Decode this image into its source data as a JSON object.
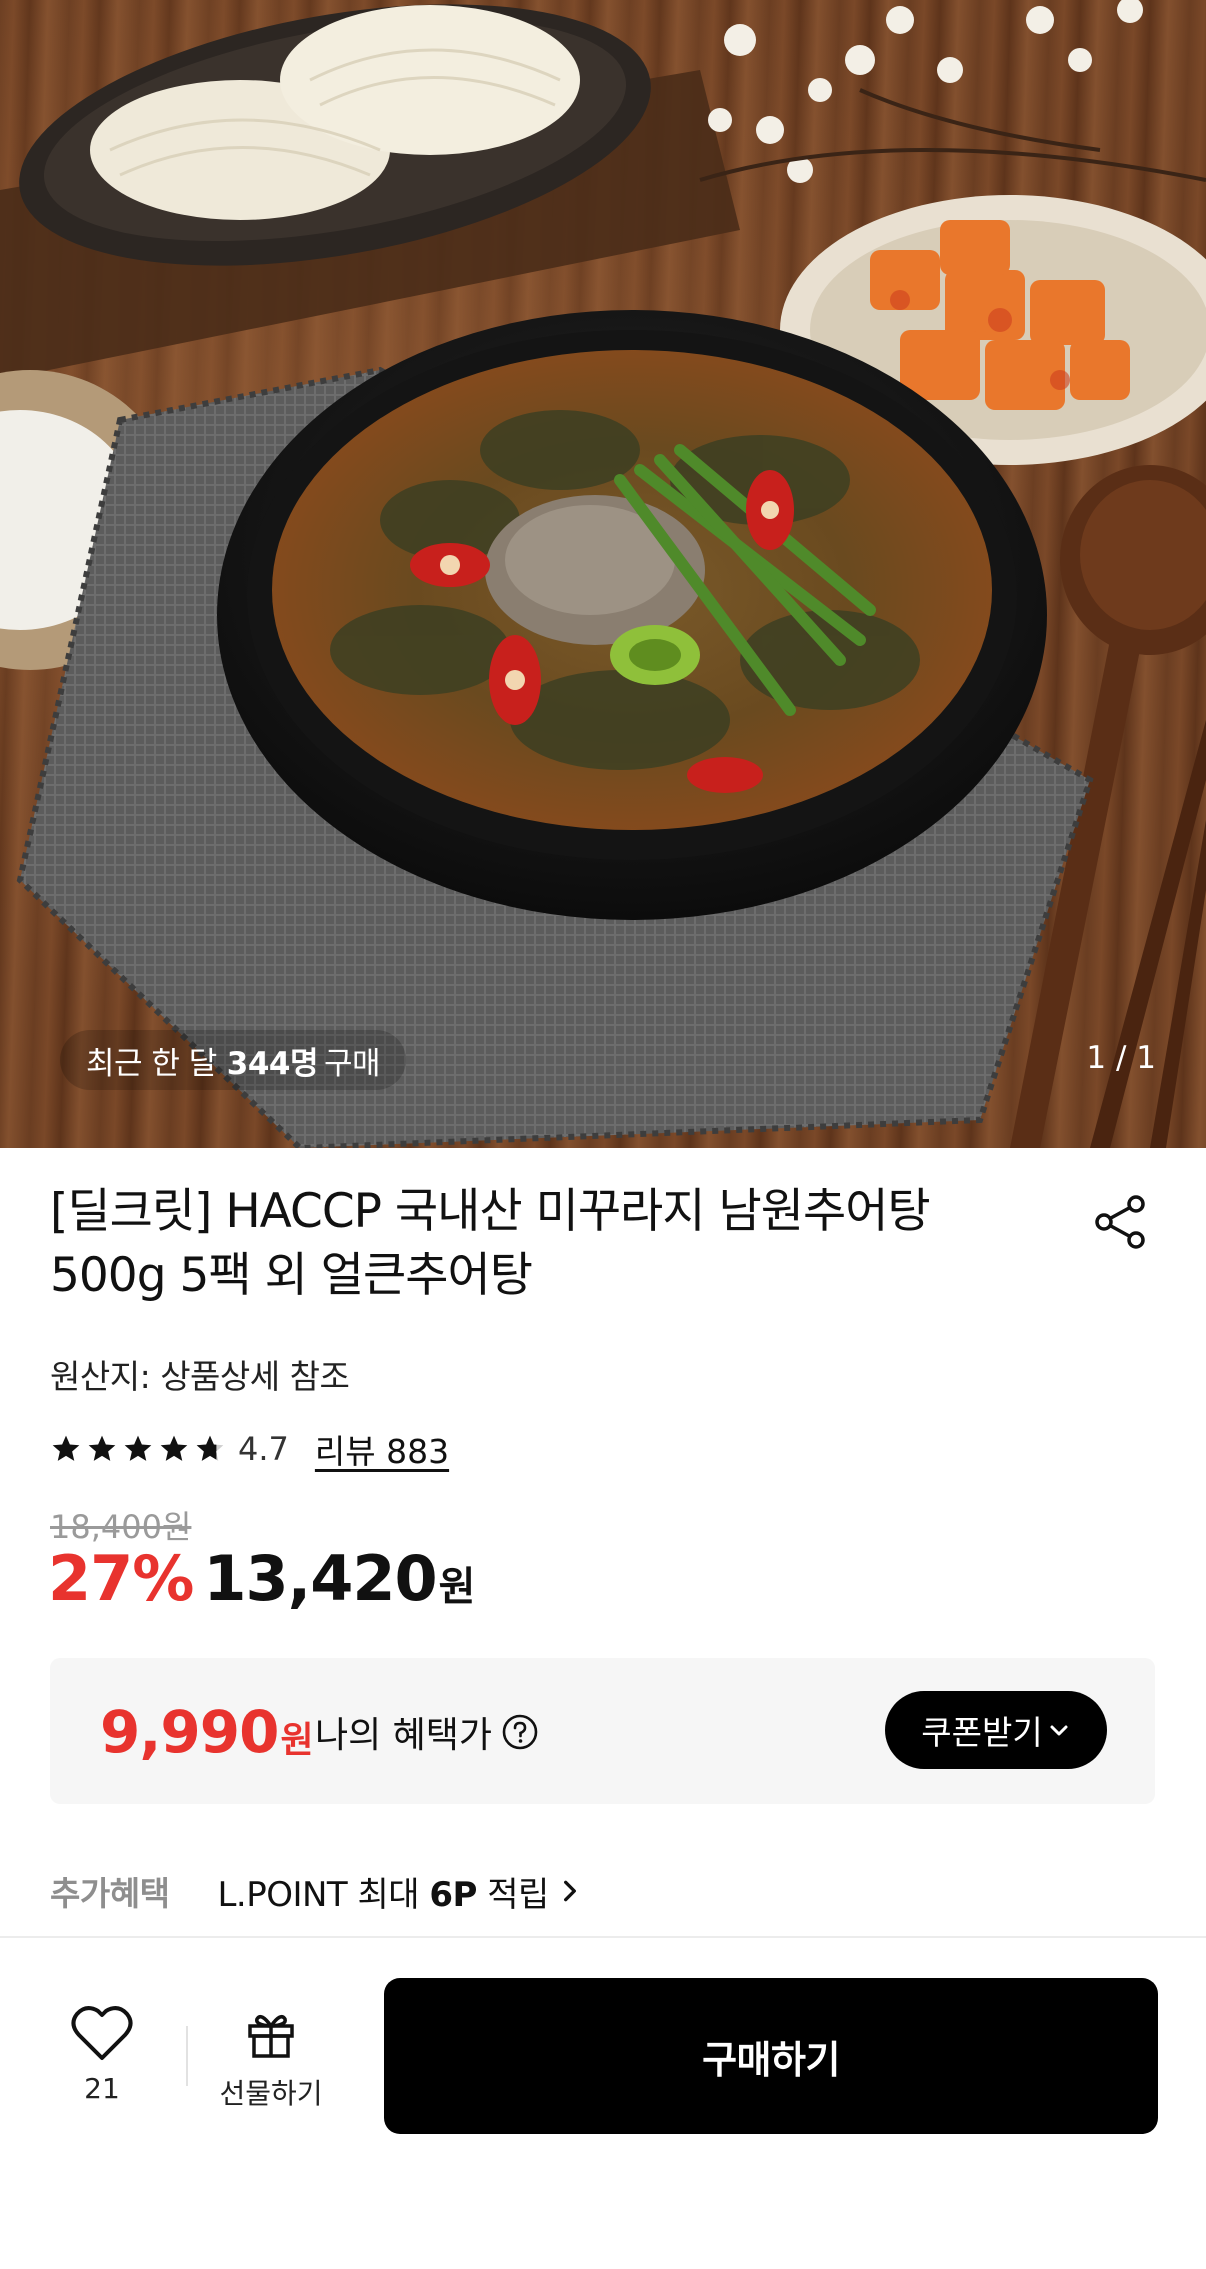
{
  "hero": {
    "caption_prefix": "최근 한 달",
    "caption_count": "344명",
    "caption_suffix": "구매",
    "counter": "1 / 1"
  },
  "product": {
    "title": "[딜크릿] HACCP 국내산 미꾸라지 남원추어탕 500g 5팩 외 얼큰추어탕",
    "origin": "원산지: 상품상세 참조",
    "rating": "4.7",
    "rating_stars": 4.7,
    "review_link": "리뷰 883",
    "original_price": "18,400원",
    "discount": "27%",
    "price": "13,420",
    "price_unit": "원"
  },
  "benefit": {
    "price": "9,990",
    "price_unit": "원",
    "label": "나의 혜택가",
    "coupon_button": "쿠폰받기"
  },
  "extra": {
    "label": "추가혜택",
    "text_prefix": "L.POINT 최대",
    "points": "6P",
    "text_suffix": "적립"
  },
  "bottom_bar": {
    "like_count": "21",
    "gift_label": "선물하기",
    "buy_label": "구매하기"
  },
  "colors": {
    "accent_red": "#e8332e",
    "button_black": "#000000",
    "benefit_bg": "#f6f6f6"
  }
}
